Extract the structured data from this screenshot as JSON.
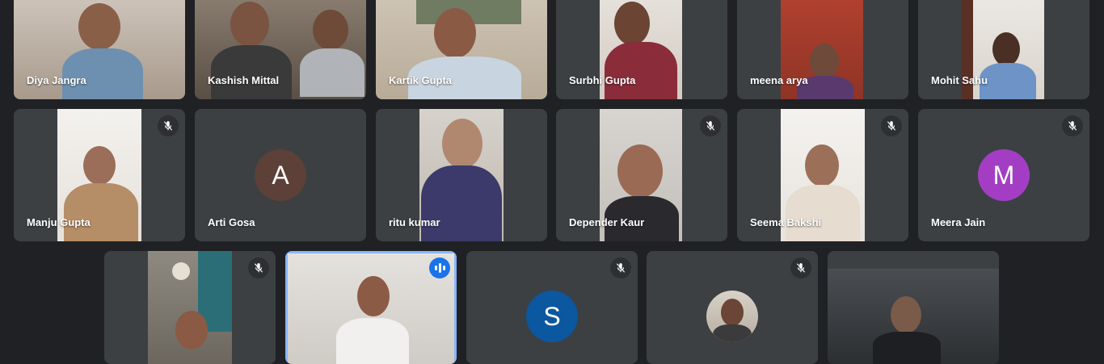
{
  "participants": [
    {
      "name": "Diya Jangra",
      "muted": false
    },
    {
      "name": "Kashish Mittal",
      "muted": false
    },
    {
      "name": "Kartik Gupta",
      "muted": false
    },
    {
      "name": "Surbhi Gupta",
      "muted": false
    },
    {
      "name": "meena arya",
      "muted": false
    },
    {
      "name": "Mohit Sahu",
      "muted": false
    },
    {
      "name": "Manju Gupta",
      "muted": true
    },
    {
      "name": "Arti Gosa",
      "muted": false,
      "avatar_letter": "A",
      "avatar_color": "#5d4037"
    },
    {
      "name": "ritu kumar",
      "muted": false
    },
    {
      "name": "Depender Kaur",
      "muted": true
    },
    {
      "name": "Seema Bakshi",
      "muted": true
    },
    {
      "name": "Meera Jain",
      "muted": true,
      "avatar_letter": "M",
      "avatar_color": "#a33ec4"
    },
    {
      "name": "",
      "muted": true
    },
    {
      "name": "",
      "muted": false,
      "speaking": true
    },
    {
      "name": "",
      "muted": true,
      "avatar_letter": "S",
      "avatar_color": "#0b57a0"
    },
    {
      "name": "",
      "muted": true
    },
    {
      "name": "",
      "muted": false
    }
  ],
  "icons": {
    "mute": "mic-off-icon",
    "speaking": "audio-level-icon"
  }
}
